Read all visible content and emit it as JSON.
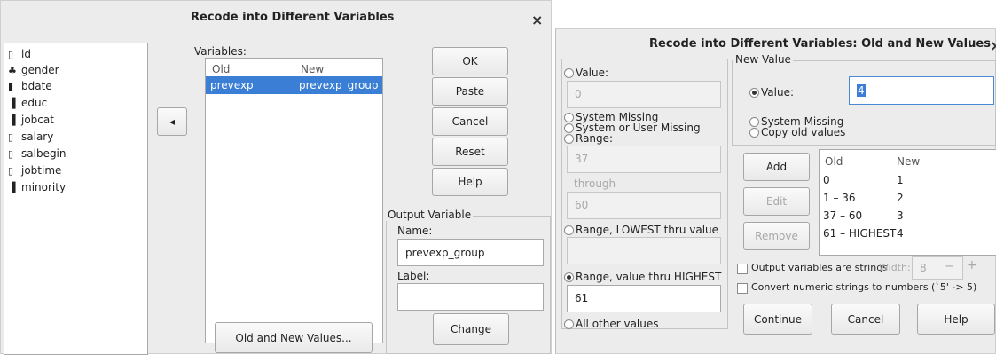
{
  "dialog1": {
    "title": "Recode into Different Variables",
    "close": "×",
    "source_vars": [
      {
        "icon": "scale-icon",
        "glyph": "▯",
        "name": "id"
      },
      {
        "icon": "nominal-icon",
        "glyph": "♣",
        "name": "gender"
      },
      {
        "icon": "date-icon",
        "glyph": "▮",
        "name": "bdate"
      },
      {
        "icon": "ordinal-icon",
        "glyph": "▐",
        "name": "educ"
      },
      {
        "icon": "ordinal-icon",
        "glyph": "▐",
        "name": "jobcat"
      },
      {
        "icon": "scale-icon",
        "glyph": "▯",
        "name": "salary"
      },
      {
        "icon": "scale-icon",
        "glyph": "▯",
        "name": "salbegin"
      },
      {
        "icon": "scale-icon",
        "glyph": "▯",
        "name": "jobtime"
      },
      {
        "icon": "ordinal-icon",
        "glyph": "▐",
        "name": "minority"
      }
    ],
    "move_arrow": "◂",
    "variables_label": "Variables:",
    "col_old": "Old",
    "col_new": "New",
    "row_old": "prevexp",
    "row_new": "prevexp_group",
    "buttons": {
      "ok": "OK",
      "paste": "Paste",
      "cancel": "Cancel",
      "reset": "Reset",
      "help": "Help"
    },
    "output_variable": "Output Variable",
    "name_label": "Name:",
    "name_value": "prevexp_group",
    "label_label": "Label:",
    "label_value": "",
    "change": "Change",
    "old_new_values": "Old and New Values..."
  },
  "dialog2": {
    "title": "Recode into Different Variables: Old and New Values",
    "close": "×",
    "value_label": "Value:",
    "value_field": "0",
    "system_missing": "System Missing",
    "system_or_user_missing": "System or User Missing",
    "range_label": "Range:",
    "range_from": "37",
    "through": "through",
    "range_to": "60",
    "range_lowest": "Range, LOWEST thru value",
    "range_lowest_field": "",
    "range_highest": "Range, value thru HIGHEST",
    "range_highest_field": "61",
    "all_other": "All other values",
    "new_value_group": "New Value",
    "nv_value_label": "Value:",
    "nv_value_field": "4",
    "nv_system_missing": "System Missing",
    "nv_copy_old": "Copy old values",
    "add": "Add",
    "edit": "Edit",
    "remove": "Remove",
    "col_old": "Old",
    "col_new": "New",
    "rows": [
      {
        "old": "0",
        "new": "1"
      },
      {
        "old": "1 – 36",
        "new": "2"
      },
      {
        "old": "37 – 60",
        "new": "3"
      },
      {
        "old": "61 – HIGHEST",
        "new": "4"
      }
    ],
    "output_strings": "Output variables are strings",
    "width_label": "Width:",
    "width_value": "8",
    "minus": "−",
    "plus": "+",
    "convert_numeric": "Convert numeric strings to numbers (`5' -> 5)",
    "continue": "Continue",
    "cancel": "Cancel",
    "help": "Help"
  }
}
